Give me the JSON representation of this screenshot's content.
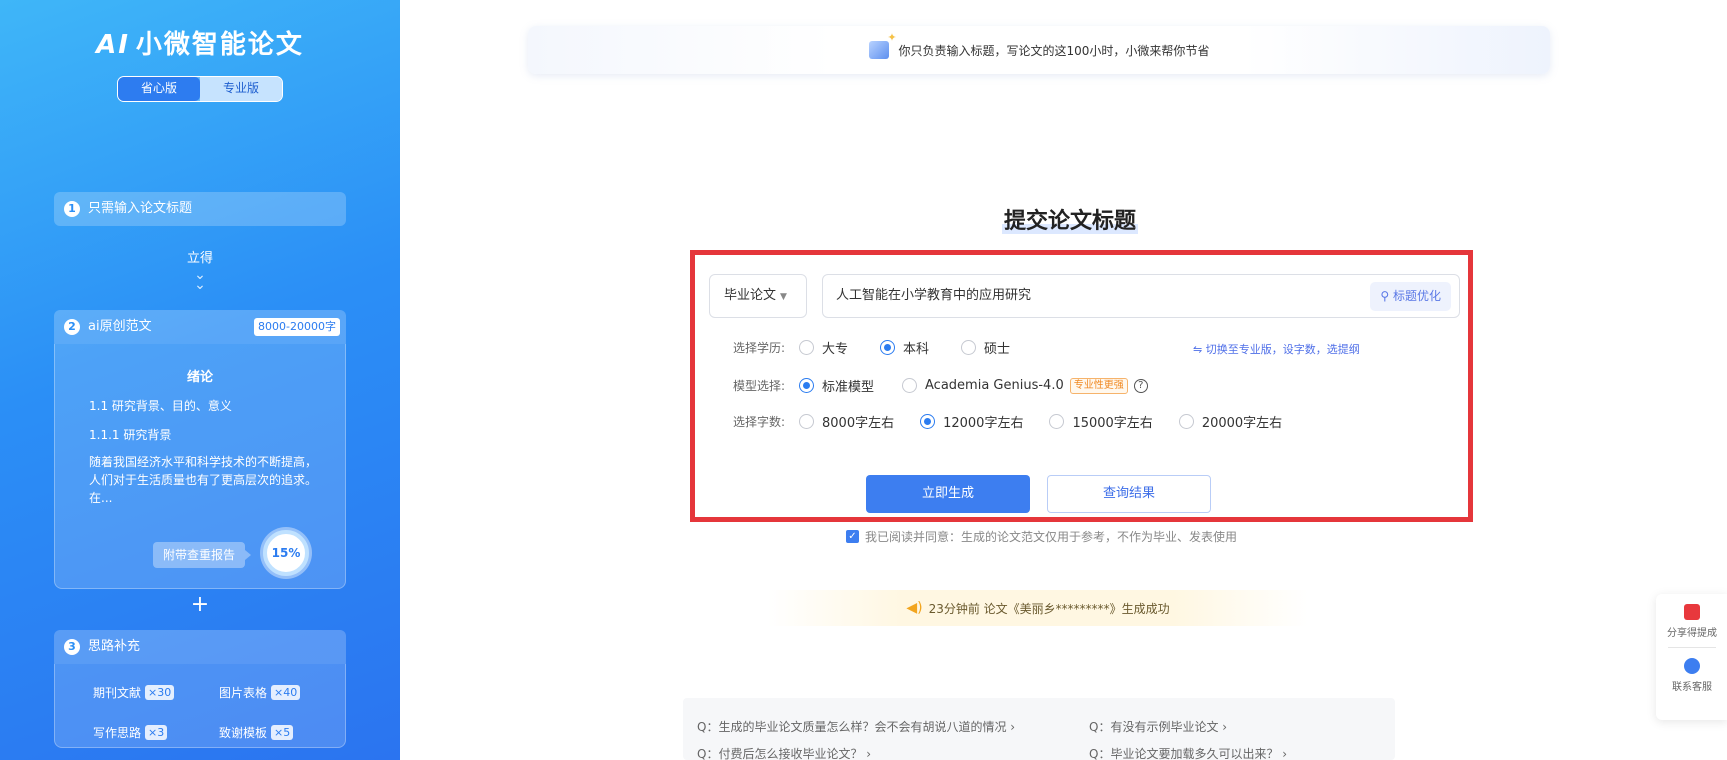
{
  "sidebar": {
    "logo_mark": "AI",
    "logo_text": "小微智能论文",
    "version_tabs": [
      "省心版",
      "专业版"
    ],
    "step1": {
      "num": "1",
      "label": "只需输入论文标题"
    },
    "instant": "立得",
    "step2": {
      "num": "2",
      "label": "ai原创范文",
      "tag": "8000-20000字"
    },
    "essay": {
      "heading": "绪论",
      "line1": "1.1 研究背景、目的、意义",
      "line2": "1.1.1 研究背景",
      "para": "随着我国经济水平和科学技术的不断提高，人们对于生活质量也有了更高层次的追求。在..."
    },
    "report_tag": "附带查重报告",
    "percent": "15%",
    "plus": "+",
    "step3": {
      "num": "3",
      "label": "思路补充"
    },
    "ideas": [
      {
        "label": "期刊文献",
        "count": "×30"
      },
      {
        "label": "图片表格",
        "count": "×40"
      },
      {
        "label": "写作思路",
        "count": "×3"
      },
      {
        "label": "致谢模板",
        "count": "×5"
      }
    ]
  },
  "banner": {
    "text": "你只负责输入标题，写论文的这100小时，小微来帮你节省"
  },
  "main": {
    "title": "提交论文标题",
    "type_select": "毕业论文",
    "title_value": "人工智能在小学教育中的应用研究",
    "optimize_btn": "标题优化",
    "edu_label": "选择学历:",
    "edu_options": [
      "大专",
      "本科",
      "硕士"
    ],
    "switch_link": "切换至专业版，设字数，选提纲",
    "model_label": "模型选择:",
    "model_options": [
      "标准模型",
      "Academia Genius-4.0"
    ],
    "pro_badge": "专业性更强",
    "words_label": "选择字数:",
    "word_options": [
      "8000字左右",
      "12000字左右",
      "15000字左右",
      "20000字左右"
    ],
    "generate_btn": "立即生成",
    "query_btn": "查询结果",
    "agree_text": "我已阅读并同意：生成的论文范文仅用于参考，不作为毕业、发表使用",
    "notice": "23分钟前  论文《美丽乡*********》生成成功",
    "faq": [
      "Q：生成的毕业论文质量怎么样？会不会有胡说八道的情况 ›",
      "Q：有没有示例毕业论文 ›",
      "Q：付费后怎么接收毕业论文？ ›",
      "Q：毕业论文要加载多久可以出来？ ›"
    ]
  },
  "float": {
    "share": "分享得提成",
    "service": "联系客服"
  },
  "colors": {
    "accent": "#3d7ef0",
    "highlight": "#e5363b",
    "sidebar": "#2b8ff6"
  }
}
